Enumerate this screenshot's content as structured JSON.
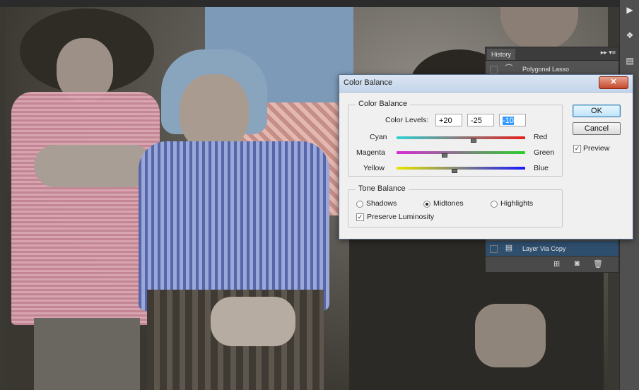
{
  "history": {
    "tab": "History",
    "controls": "▸▸  ▾≡",
    "items": [
      {
        "label": "Polygonal Lasso",
        "selected": false
      },
      {
        "label": "Layer Via Copy",
        "selected": true
      }
    ]
  },
  "dialog": {
    "title": "Color Balance",
    "close_label": "✕",
    "color_balance": {
      "group_title": "Color Balance",
      "levels_label": "Color Levels:",
      "levels": [
        "+20",
        "-25",
        "-10"
      ],
      "sliders": [
        {
          "left": "Cyan",
          "right": "Red",
          "value": 20,
          "color_left": "#2fd2d2",
          "color_right": "#e81f1f"
        },
        {
          "left": "Magenta",
          "right": "Green",
          "value": -25,
          "color_left": "#d62bd6",
          "color_right": "#2ccf2c"
        },
        {
          "left": "Yellow",
          "right": "Blue",
          "value": -10,
          "color_left": "#e6e600",
          "color_right": "#1a1aff"
        }
      ]
    },
    "tone_balance": {
      "group_title": "Tone Balance",
      "options": [
        {
          "label": "Shadows",
          "selected": false
        },
        {
          "label": "Midtones",
          "selected": true
        },
        {
          "label": "Highlights",
          "selected": false
        }
      ],
      "preserve_luminosity_label": "Preserve Luminosity",
      "preserve_luminosity_checked": true
    },
    "ok_label": "OK",
    "cancel_label": "Cancel",
    "preview_label": "Preview",
    "preview_checked": true
  },
  "dock_icons": [
    "play-icon",
    "info-icon",
    "adjustments-icon"
  ],
  "dock_glyphs": [
    "▶",
    "❖",
    "▤"
  ]
}
